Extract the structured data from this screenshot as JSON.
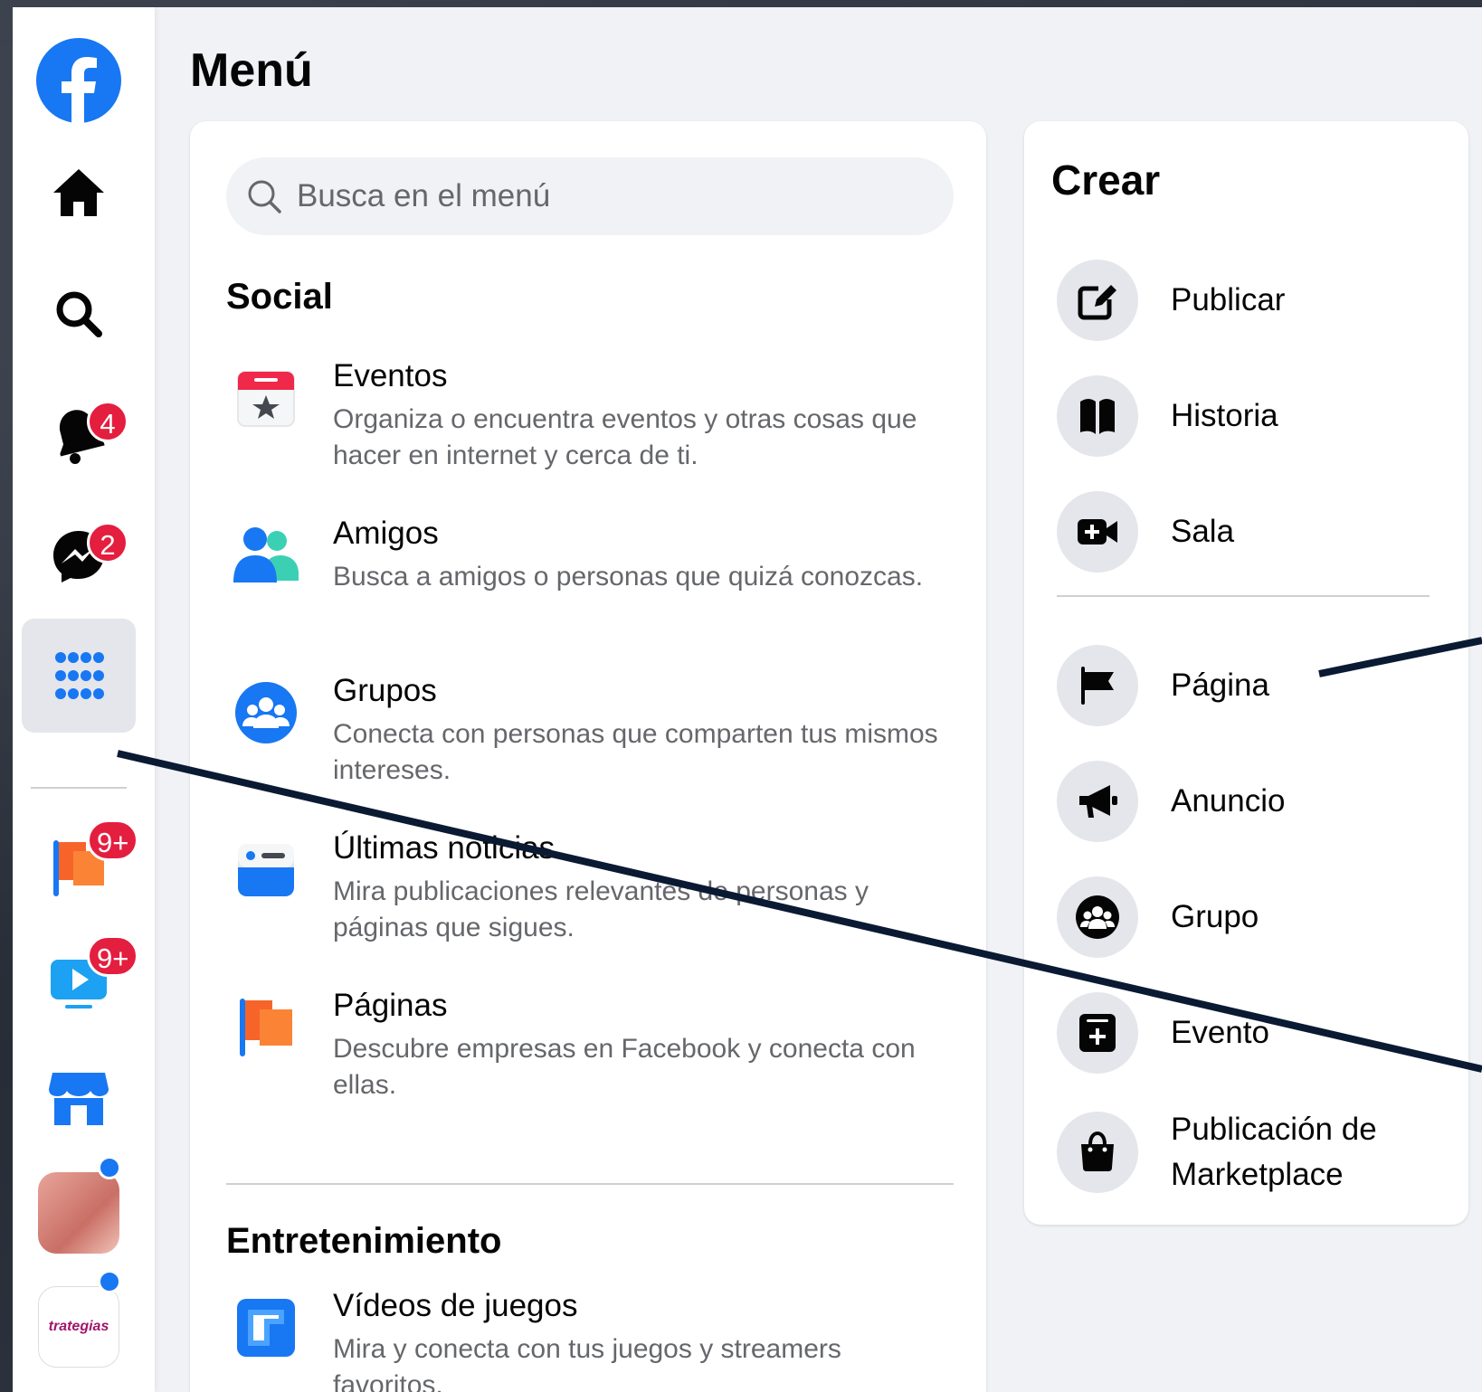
{
  "page_title": "Menú",
  "rail": {
    "notifications_badge": "4",
    "messenger_badge": "2",
    "pages_badge": "9+",
    "watch_badge": "9+",
    "shortcut_text": "trategias"
  },
  "search": {
    "placeholder": "Busca en el menú"
  },
  "sections": {
    "social": {
      "title": "Social",
      "items": [
        {
          "title": "Eventos",
          "desc": "Organiza o encuentra eventos y otras cosas que hacer en internet y cerca de ti."
        },
        {
          "title": "Amigos",
          "desc": "Busca a amigos o personas que quizá conozcas."
        },
        {
          "title": "Grupos",
          "desc": "Conecta con personas que comparten tus mismos intereses."
        },
        {
          "title": "Últimas noticias",
          "desc": "Mira publicaciones relevantes de personas y páginas que sigues."
        },
        {
          "title": "Páginas",
          "desc": "Descubre empresas en Facebook y conecta con ellas."
        }
      ]
    },
    "entertainment": {
      "title": "Entretenimiento",
      "items": [
        {
          "title": "Vídeos de juegos",
          "desc": "Mira y conecta con tus juegos y streamers favoritos."
        }
      ]
    }
  },
  "create": {
    "title": "Crear",
    "items": [
      {
        "label": "Publicar",
        "icon": "edit-icon"
      },
      {
        "label": "Historia",
        "icon": "book-icon"
      },
      {
        "label": "Sala",
        "icon": "video-plus-icon"
      },
      {
        "label": "Página",
        "icon": "flag-icon"
      },
      {
        "label": "Anuncio",
        "icon": "megaphone-icon"
      },
      {
        "label": "Grupo",
        "icon": "group-icon"
      },
      {
        "label": "Evento",
        "icon": "calendar-plus-icon"
      },
      {
        "label": "Publicación de Marketplace",
        "icon": "shopping-bag-icon"
      }
    ]
  },
  "colors": {
    "brand": "#1877f2",
    "badge": "#e41e3f",
    "annotation_line": "#0b1a33"
  }
}
